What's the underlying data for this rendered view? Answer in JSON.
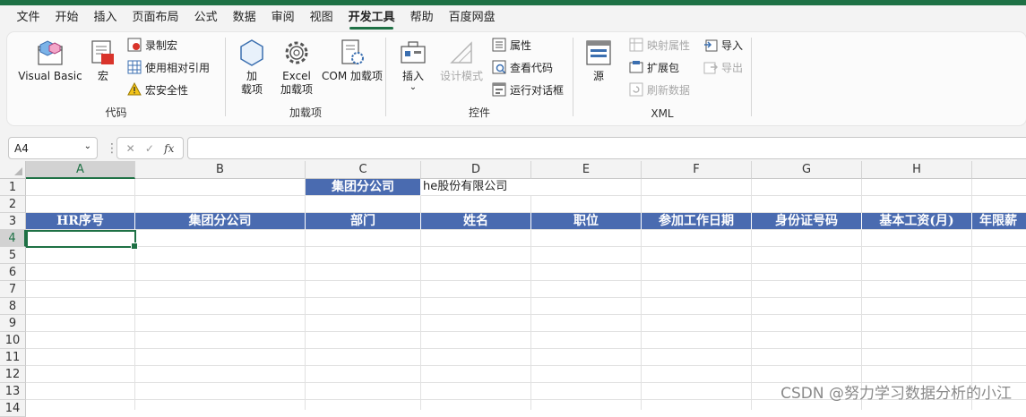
{
  "menu": [
    "文件",
    "开始",
    "插入",
    "页面布局",
    "公式",
    "数据",
    "审阅",
    "视图",
    "开发工具",
    "帮助",
    "百度网盘"
  ],
  "ribbon": {
    "code": {
      "label": "代码",
      "visual_basic": "Visual Basic",
      "macro": "宏",
      "record_macro": "录制宏",
      "relative_ref": "使用相对引用",
      "macro_security": "宏安全性"
    },
    "addins": {
      "label": "加载项",
      "addins_line1": "加",
      "addins_line2": "载项",
      "excel_line1": "Excel",
      "excel_line2": "加载项",
      "com": "COM 加载项"
    },
    "controls": {
      "label": "控件",
      "insert": "插入",
      "design_mode": "设计模式",
      "properties": "属性",
      "view_code": "查看代码",
      "run_dialog": "运行对话框"
    },
    "xml": {
      "label": "XML",
      "source": "源",
      "map_props": "映射属性",
      "expansion": "扩展包",
      "refresh": "刷新数据",
      "import": "导入",
      "export": "导出"
    }
  },
  "formula": {
    "namebox": "A4",
    "fx": "fx",
    "value": ""
  },
  "columns": [
    "A",
    "B",
    "C",
    "D",
    "E",
    "F",
    "G",
    "H"
  ],
  "rows": [
    "1",
    "2",
    "3",
    "4",
    "5",
    "6",
    "7",
    "8",
    "9",
    "10",
    "11",
    "12",
    "13",
    "14"
  ],
  "cells": {
    "c1": "集团分公司",
    "d1": "he股份有限公司"
  },
  "headers": [
    "HR序号",
    "集团分公司",
    "部门",
    "姓名",
    "职位",
    "参加工作日期",
    "身份证号码",
    "基本工资(月)",
    "年限薪"
  ],
  "watermark": "CSDN @努力学习数据分析的小江",
  "colors": {
    "accent": "#1e7145",
    "header_fill": "#4a6bb0"
  }
}
